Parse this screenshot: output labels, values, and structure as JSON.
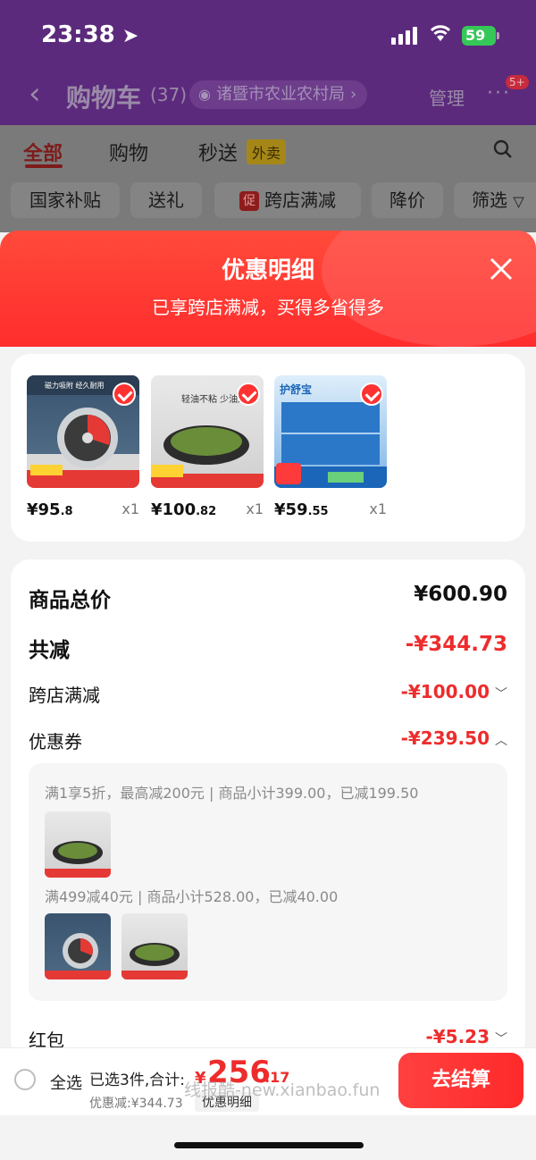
{
  "status": {
    "time": "23:38",
    "battery": "59"
  },
  "header": {
    "title": "购物车",
    "count": "(37)",
    "address": "诸暨市农业农村局",
    "manage": "管理",
    "more_badge": "5+"
  },
  "tabs": [
    {
      "label": "全部"
    },
    {
      "label": "购物"
    },
    {
      "label": "秒送"
    }
  ],
  "waimai_tag": "外卖",
  "chips": [
    {
      "label": "国家补贴"
    },
    {
      "label": "送礼"
    },
    {
      "label": "跨店满减",
      "tag": "促"
    },
    {
      "label": "降价"
    },
    {
      "label": "筛选"
    }
  ],
  "sheet": {
    "title": "优惠明细",
    "subtitle": "已享跨店满减，买得多省得多"
  },
  "products": [
    {
      "price_int": "¥95",
      "price_dec": ".8",
      "qty": "x1",
      "img_text": "磁力吸附 经久耐用"
    },
    {
      "price_int": "¥100",
      "price_dec": ".82",
      "qty": "x1",
      "img_text": "轻油不粘 少油烟"
    },
    {
      "price_int": "¥59",
      "price_dec": ".55",
      "qty": "x1",
      "img_text": "护舒宝"
    }
  ],
  "summary": {
    "total_label": "商品总价",
    "total_value": "¥600.90",
    "reduce_label": "共减",
    "reduce_value": "-¥344.73",
    "cross_label": "跨店满减",
    "cross_value": "-¥100.00",
    "coupon_label": "优惠券",
    "coupon_value": "-¥239.50",
    "redpack_label": "红包",
    "redpack_value": "-¥5.23"
  },
  "coupons": [
    {
      "text": "满1享5折，最高减200元 | 商品小计399.00，已减199.50"
    },
    {
      "text": "满499减40元 | 商品小计528.00，已减40.00"
    }
  ],
  "bottom": {
    "select_all": "全选",
    "selected_text": "已选3件,合计:",
    "yen": "¥",
    "total_int": "256",
    "total_dec": ".17",
    "saved": "优惠减:¥344.73",
    "detail": "优惠明细",
    "checkout": "去结算",
    "watermark": "线报酷-new.xianbao.fun"
  },
  "colors": {
    "accent": "#ff2d2d",
    "header_purple": "#5c2a7c"
  }
}
